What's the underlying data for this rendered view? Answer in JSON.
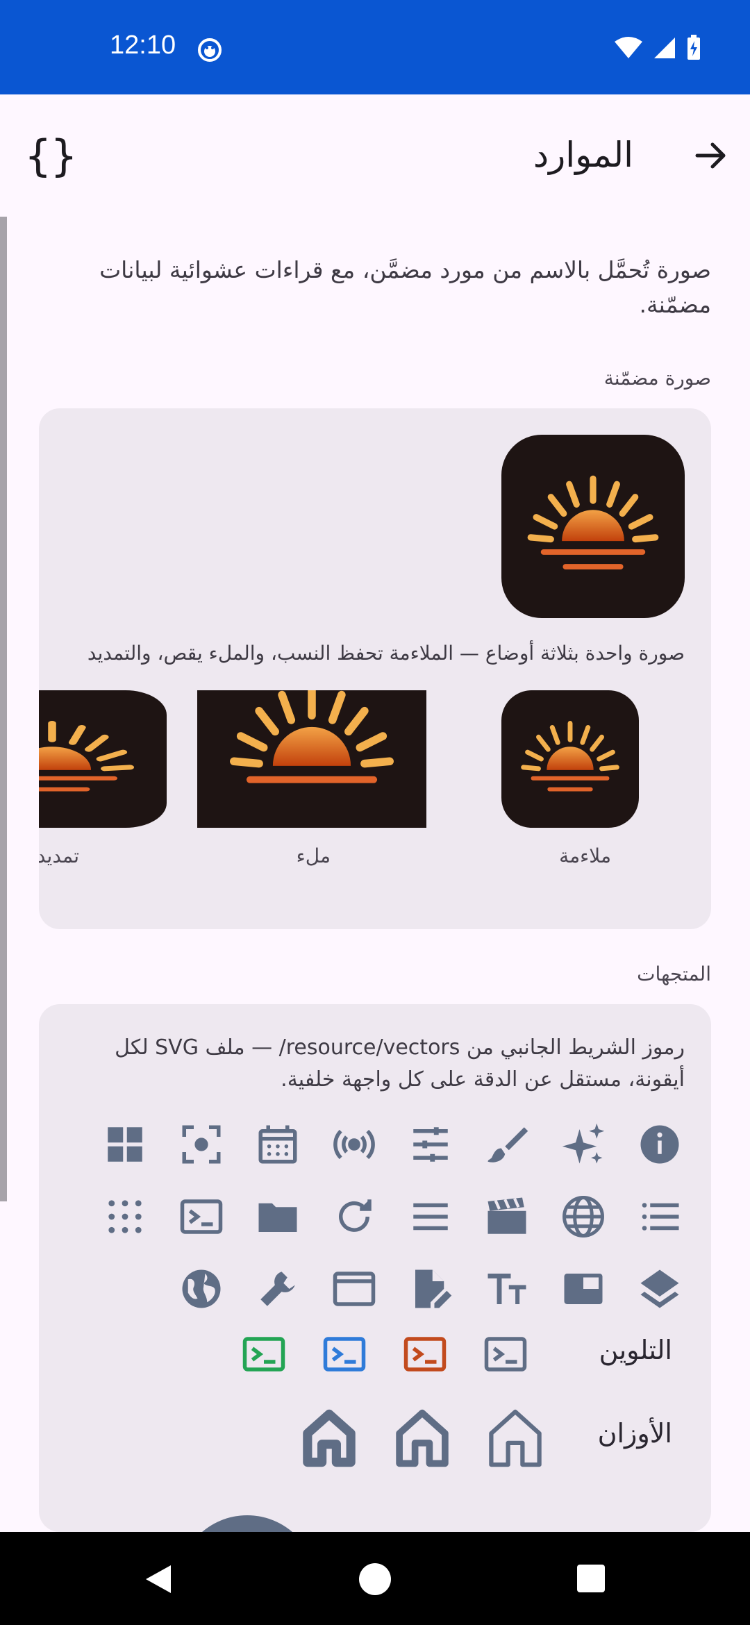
{
  "status_bar": {
    "time": "12:10"
  },
  "app_bar": {
    "title": "الموارد",
    "code_glyph": "{}"
  },
  "intro_text": "صورة تُحمَّل بالاسم من مورد مضمَّن، مع قراءات عشوائية لبيانات مضمّنة.",
  "embedded_section": {
    "label": "صورة مضمّنة",
    "modes_caption": "صورة واحدة بثلاثة أوضاع — الملاءمة تحفظ النسب، والملء يقص، والتمديد",
    "modes": [
      {
        "label": "ملاءمة"
      },
      {
        "label": "ملء"
      },
      {
        "label": "تمديد"
      }
    ]
  },
  "vectors_section": {
    "label": "المتجهات",
    "caption": "رموز الشريط الجانبي من resource/vectors/ — ملف SVG لكل أيقونة، مستقل عن الدقة على كل واجهة خلفية.",
    "icon_rows": [
      [
        "info-icon",
        "sparkle-icon",
        "brush-icon",
        "tune-icon",
        "broadcast-icon",
        "calendar-icon",
        "center-focus-icon",
        "grid-icon"
      ],
      [
        "list-icon",
        "globe-icon",
        "clapperboard-icon",
        "menu-icon",
        "refresh-icon",
        "folder-icon",
        "terminal-icon",
        "dots-grid-icon"
      ],
      [
        "layers-icon",
        "picture-in-picture-icon",
        "text-size-icon",
        "edit-document-icon",
        "window-icon",
        "wrench-icon",
        "earth-icon"
      ]
    ],
    "tinting_label": "التلوين",
    "tint_colors": [
      "#5F6D85",
      "#C24A1D",
      "#2F7BD9",
      "#23A454"
    ],
    "weights_label": "الأوزان",
    "weights_color": "#5F6D85"
  },
  "colors": {
    "status_bar": "#0A56D2",
    "icon": "#5F6D85",
    "card": "#EEE8F0",
    "background": "#FEF7FF"
  }
}
